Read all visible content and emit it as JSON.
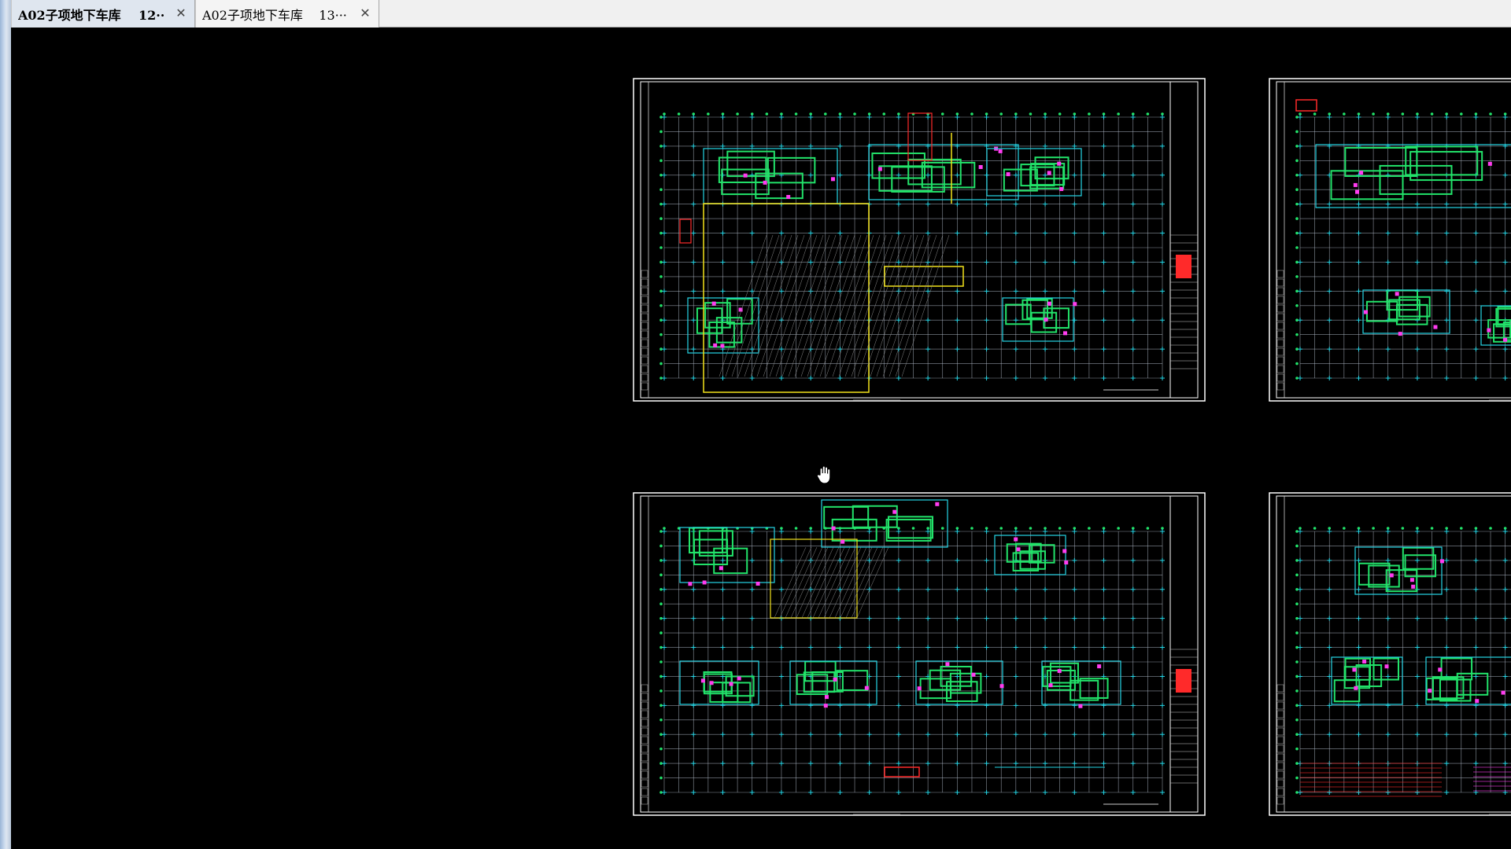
{
  "tabs": [
    {
      "label": "A02子项地下车库    12··",
      "active": true
    },
    {
      "label": "A02子项地下车库    13···",
      "active": false
    }
  ],
  "icons": {
    "tab_close": "close-icon",
    "cursor": "hand-pan-cursor-icon"
  },
  "colors": {
    "canvas": "#000000",
    "sheet_border": "#ffffff",
    "grid": "#b9c3d2",
    "walls": "#22e36a",
    "cyan": "#25d6e6",
    "yellow": "#f2e21a",
    "magenta": "#ff3cf0",
    "red": "#ff2a2a"
  }
}
